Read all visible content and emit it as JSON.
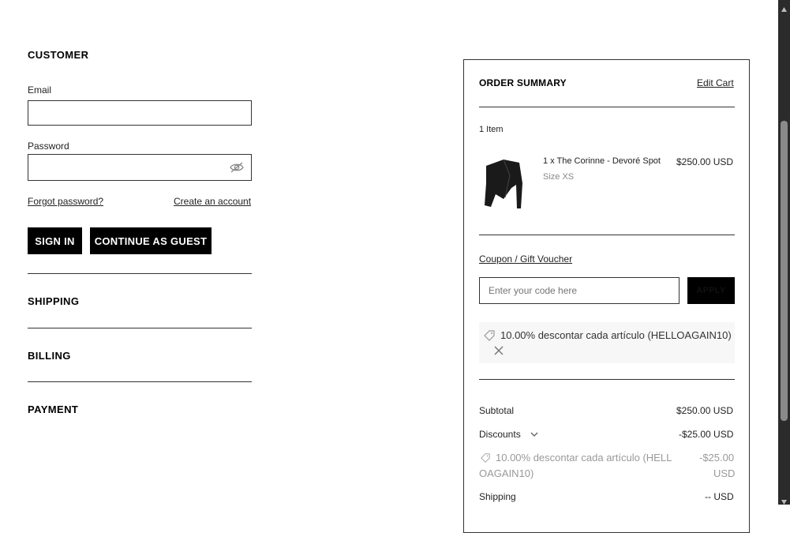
{
  "customer": {
    "title": "CUSTOMER",
    "email_label": "Email",
    "email_value": "",
    "password_label": "Password",
    "password_value": "",
    "forgot_password": "Forgot password?",
    "create_account": "Create an account",
    "sign_in": "SIGN IN",
    "continue_guest": "CONTINUE AS GUEST"
  },
  "steps": {
    "shipping": "SHIPPING",
    "billing": "BILLING",
    "payment": "PAYMENT"
  },
  "summary": {
    "title": "ORDER SUMMARY",
    "edit_cart": "Edit Cart",
    "item_count": "1 Item",
    "product": {
      "name": "1 x The Corinne - Devoré Spot",
      "price": "$250.00 USD",
      "size": "Size XS"
    },
    "coupon_link": "Coupon / Gift Voucher",
    "coupon_placeholder": "Enter your code here",
    "apply": "APPLY",
    "applied_coupon": "10.00% descontar cada artículo (HELLOAGAIN10)",
    "subtotal_label": "Subtotal",
    "subtotal_value": "$250.00 USD",
    "discounts_label": "Discounts",
    "discounts_value": "-$25.00 USD",
    "discount_line_1": "10.00% descontar cada artículo (HELL",
    "discount_line_2": "OAGAIN10)",
    "discount_amount_1": "-$25.00",
    "discount_amount_2": "USD",
    "shipping_label": "Shipping",
    "shipping_value": "-- USD"
  },
  "icons": {
    "eye": "eye-slash-icon",
    "tag": "tag-icon",
    "close": "close-icon",
    "chevron": "chevron-down-icon"
  }
}
